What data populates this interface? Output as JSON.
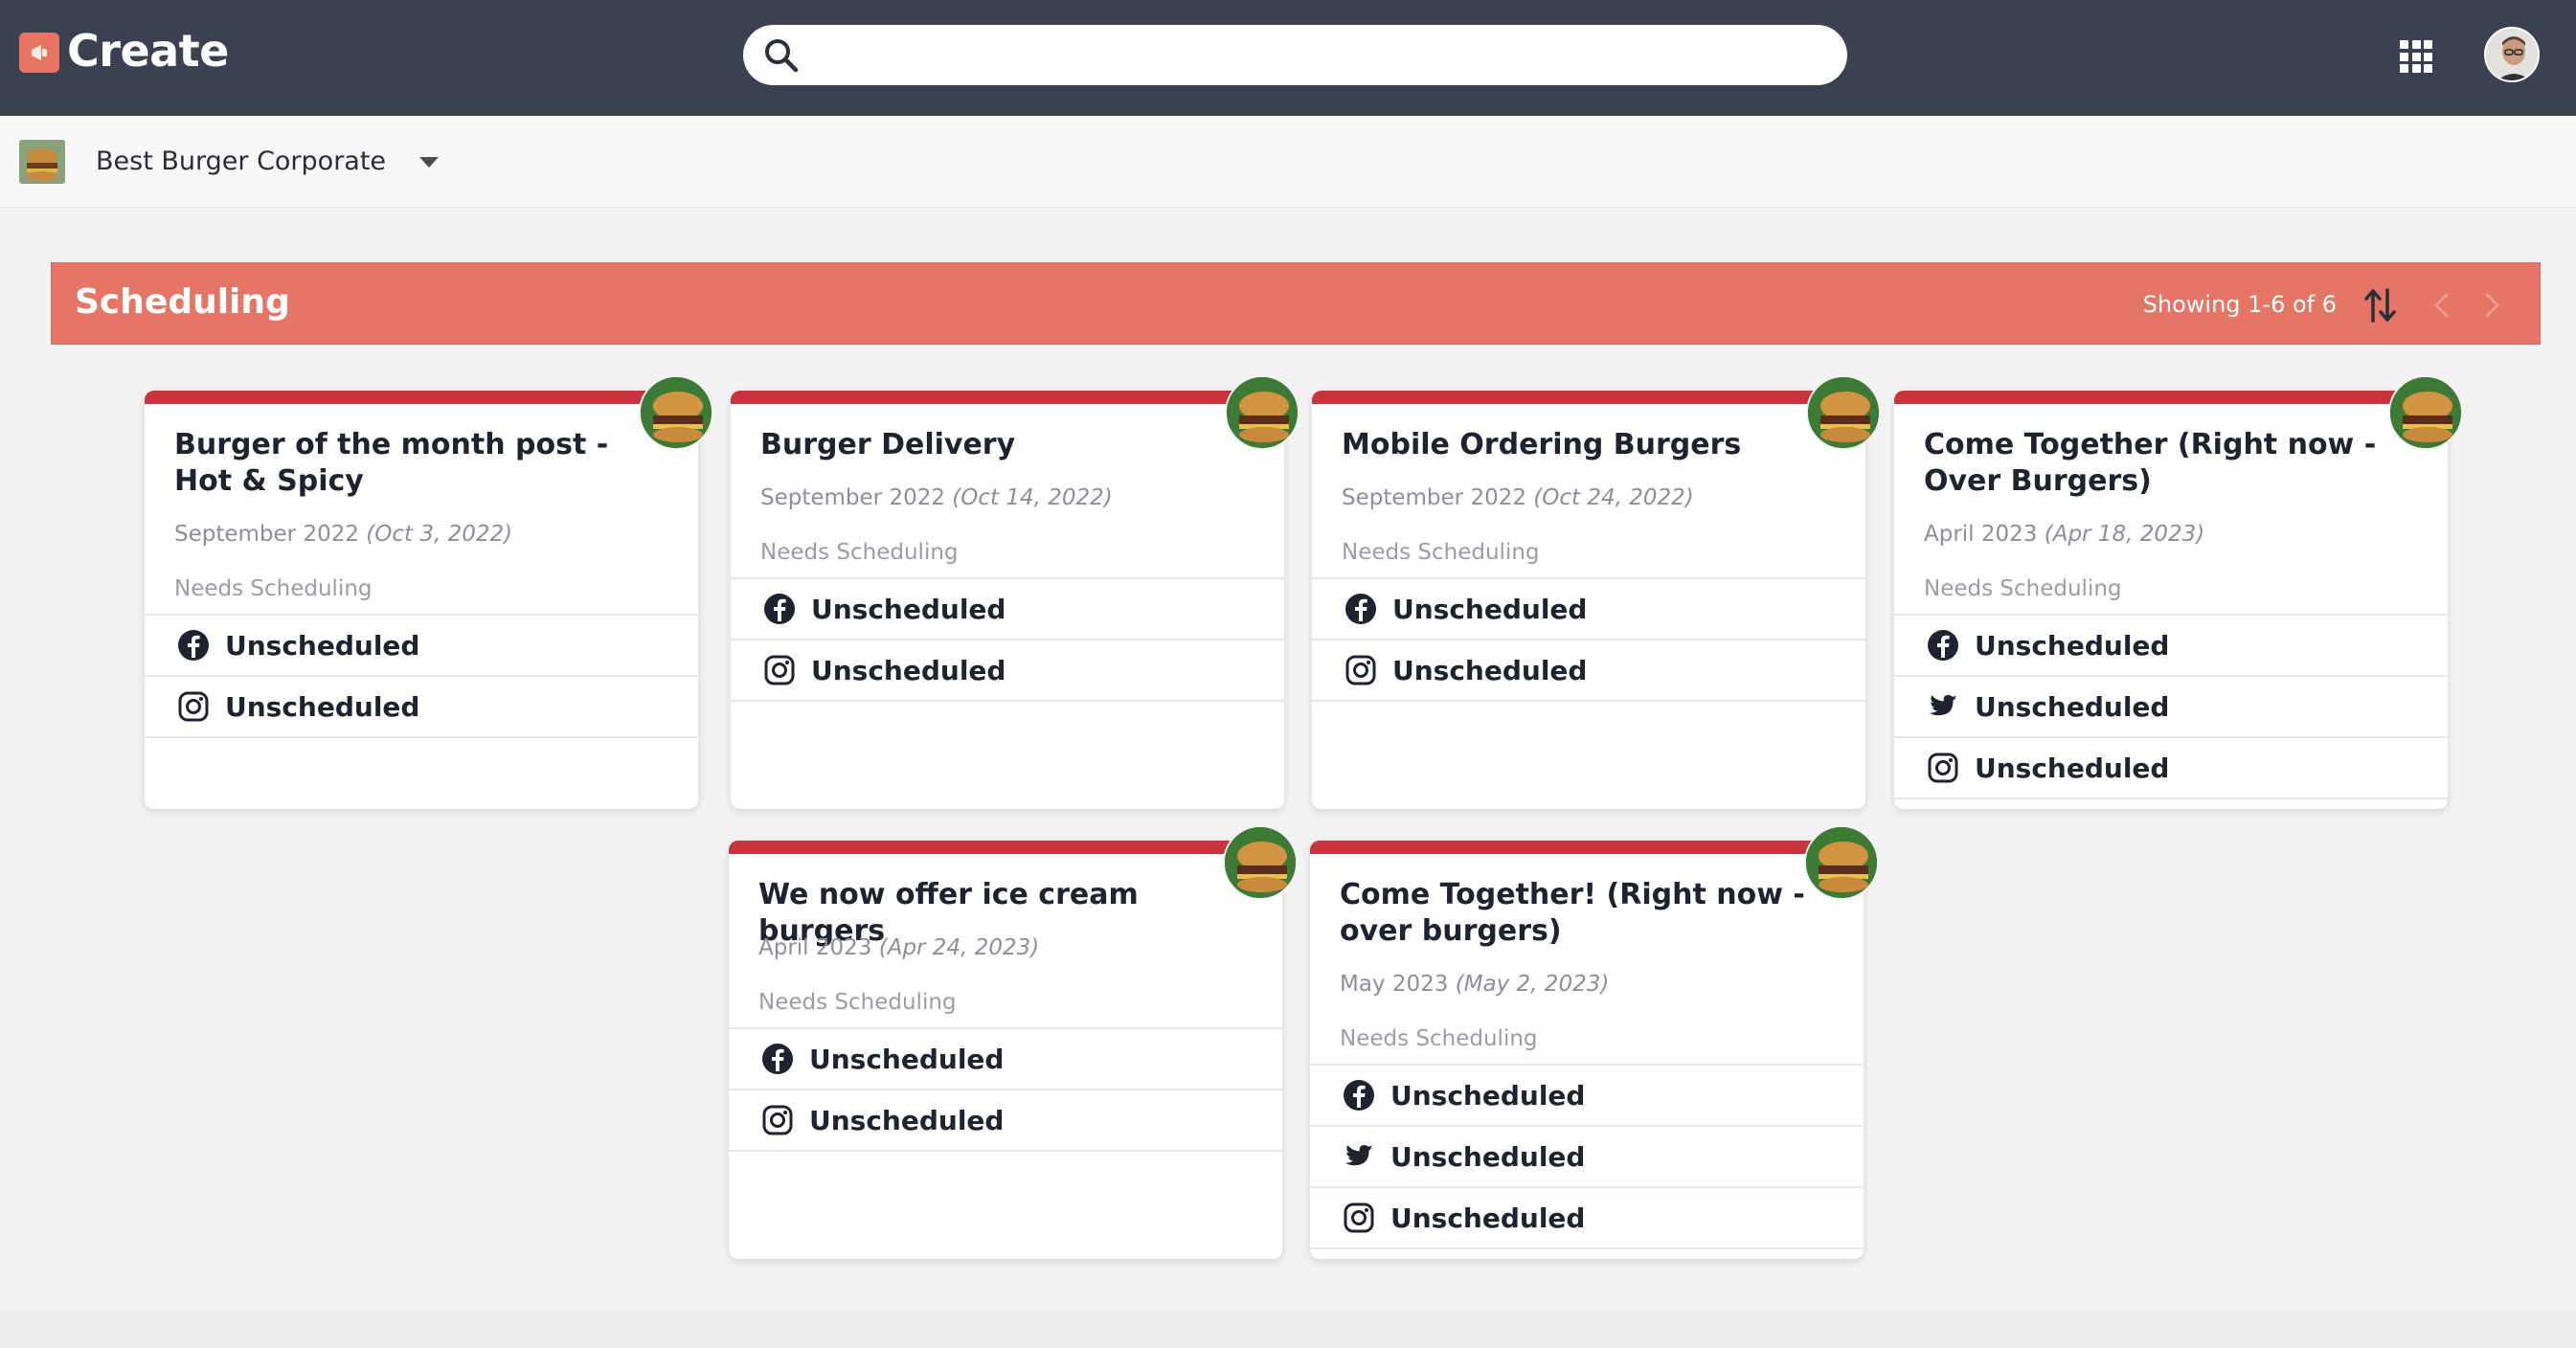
{
  "app": {
    "title": "Create"
  },
  "search": {
    "placeholder": "",
    "value": ""
  },
  "org": {
    "name": "Best Burger Corporate"
  },
  "section": {
    "title": "Scheduling",
    "showing": "Showing 1-6 of 6"
  },
  "colors": {
    "topbar": "#3b4150",
    "accent": "#e57565",
    "card_top": "#c9333d"
  },
  "cards": [
    {
      "title": "Burger of the month post - Hot & Spicy",
      "month": "September 2022",
      "date": "(Oct 3, 2022)",
      "status": "Needs Scheduling",
      "rows": [
        {
          "icon": "facebook-icon",
          "label": "Unscheduled"
        },
        {
          "icon": "instagram-icon",
          "label": "Unscheduled"
        }
      ]
    },
    {
      "title": "Burger Delivery",
      "month": "September 2022",
      "date": "(Oct 14, 2022)",
      "status": "Needs Scheduling",
      "rows": [
        {
          "icon": "facebook-icon",
          "label": "Unscheduled"
        },
        {
          "icon": "instagram-icon",
          "label": "Unscheduled"
        }
      ]
    },
    {
      "title": "Mobile Ordering Burgers",
      "month": "September 2022",
      "date": "(Oct 24, 2022)",
      "status": "Needs Scheduling",
      "rows": [
        {
          "icon": "facebook-icon",
          "label": "Unscheduled"
        },
        {
          "icon": "instagram-icon",
          "label": "Unscheduled"
        }
      ]
    },
    {
      "title": "Come Together (Right now - Over Burgers)",
      "month": "April 2023",
      "date": "(Apr 18, 2023)",
      "status": "Needs Scheduling",
      "rows": [
        {
          "icon": "facebook-icon",
          "label": "Unscheduled"
        },
        {
          "icon": "twitter-icon",
          "label": "Unscheduled"
        },
        {
          "icon": "instagram-icon",
          "label": "Unscheduled"
        }
      ]
    },
    {
      "title": "We now offer ice cream burgers",
      "month": "April 2023",
      "date": "(Apr 24, 2023)",
      "status": "Needs Scheduling",
      "rows": [
        {
          "icon": "facebook-icon",
          "label": "Unscheduled"
        },
        {
          "icon": "instagram-icon",
          "label": "Unscheduled"
        }
      ]
    },
    {
      "title": "Come Together! (Right now - over burgers)",
      "month": "May 2023",
      "date": "(May 2, 2023)",
      "status": "Needs Scheduling",
      "rows": [
        {
          "icon": "facebook-icon",
          "label": "Unscheduled"
        },
        {
          "icon": "twitter-icon",
          "label": "Unscheduled"
        },
        {
          "icon": "instagram-icon",
          "label": "Unscheduled"
        }
      ]
    }
  ]
}
